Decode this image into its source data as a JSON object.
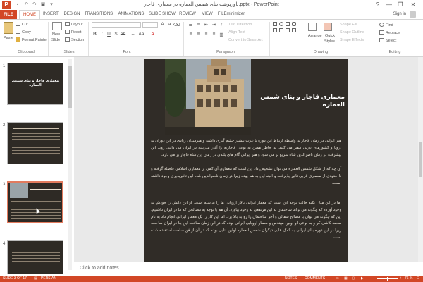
{
  "window": {
    "app_badge": "P",
    "title": "پاورپوینت بنای شمس العماره در معماری قاجار.pptx - PowerPoint",
    "help": "?",
    "min": "—",
    "max": "❐",
    "close": "✕"
  },
  "tabs": {
    "file": "FILE",
    "items": [
      "HOME",
      "INSERT",
      "DESIGN",
      "TRANSITIONS",
      "ANIMATIONS",
      "SLIDE SHOW",
      "REVIEW",
      "VIEW",
      "FILEminimizer"
    ],
    "active_index": 0,
    "signin": "Sign in"
  },
  "ribbon": {
    "clipboard": {
      "paste": "Paste",
      "cut": "Cut",
      "copy": "Copy",
      "format_painter": "Format Painter",
      "label": "Clipboard"
    },
    "slides": {
      "new_slide_1": "New",
      "new_slide_2": "Slide",
      "layout": "Layout",
      "reset": "Reset",
      "section": "Section",
      "label": "Slides"
    },
    "font": {
      "label": "Font"
    },
    "paragraph": {
      "text_direction": "Text Direction",
      "align_text": "Align Text",
      "convert": "Convert to SmartArt",
      "label": "Paragraph"
    },
    "drawing": {
      "arrange": "Arrange",
      "quick_styles_1": "Quick",
      "quick_styles_2": "Styles",
      "shape_fill": "Shape Fill",
      "shape_outline": "Shape Outline",
      "shape_effects": "Shape Effects",
      "label": "Drawing"
    },
    "editing": {
      "find": "Find",
      "replace": "Replace",
      "select": "Select",
      "label": "Editing"
    }
  },
  "thumbnails": {
    "numbers": [
      "1",
      "2",
      "3",
      "4"
    ],
    "slide1_title": "معماری قاجار و بنای شمس العماره",
    "selected_index": 2
  },
  "slide": {
    "title": "معماری قاجار و بنای شمس العماره",
    "para1": "هنر ایرانی در زمان قاجار به واسطه ارتباط این دوره با غرب بیشتر چشم گیری داشته و هنرمندان زیادی در این دوران به اروپا و کشورهای عربی سفر می کنند. به خاطر همین به نوعی قاجاریه را آغاز مدرنیته در ایران می دانند. روند این پیشرفت در زمان ناصرالدین شاه سریع تر می شود و هنر ایرانی گام های بلندی در زمان این شاه قاجار بر می دارد.",
    "para2": "آن چه که از شکل شمس العماره می توان تشخیص داد این است که معماری آن کمی از معماری اسلامی فاصله گرفته و تا حدودی از معماری غربی تاثیر پذیرفته. و البته این به هم بوده زیرا در زمان ناصرالدین شاه این تاثیرپذیری وجود داشته است.",
    "para3": "اما در این میان نکته جالب توجه این است که معمار ایرانی تالار اروپایی ها را نداشته است. او این دانش را خودش به وجود آورده که چگونه می تواند ساختمان به این مرتفعی به وجود بیاورد. آن هم با توجه به مصالحی که ما در ایران داشتیم. این که چگونه می توان با مصالح سفالی و آجر ساختمان را رو به بالا برد. اما این کار را یک معمار ایرانی انجام داد به نام محمد کاشی گر و به نوعی او اولین مهندس و معمار اروپایی ایرانی بوده که در این زمان ساخت این بنا در ایران ساخت. زیرا در این دوره بنای ایرانی به کمک هایی دیگران شمس العماره اولین بنایی بوده که در آن از فن ساخت استفاده شده است."
  },
  "notes": {
    "placeholder": "Click to add notes"
  },
  "status": {
    "slide_pos": "SLIDE 3 OF 17",
    "language": "PERSIAN",
    "notes_btn": "NOTES",
    "comments_btn": "COMMENTS",
    "zoom": "76 %"
  },
  "colors": {
    "accent": "#d24726",
    "slide_bg": "#302c27"
  }
}
